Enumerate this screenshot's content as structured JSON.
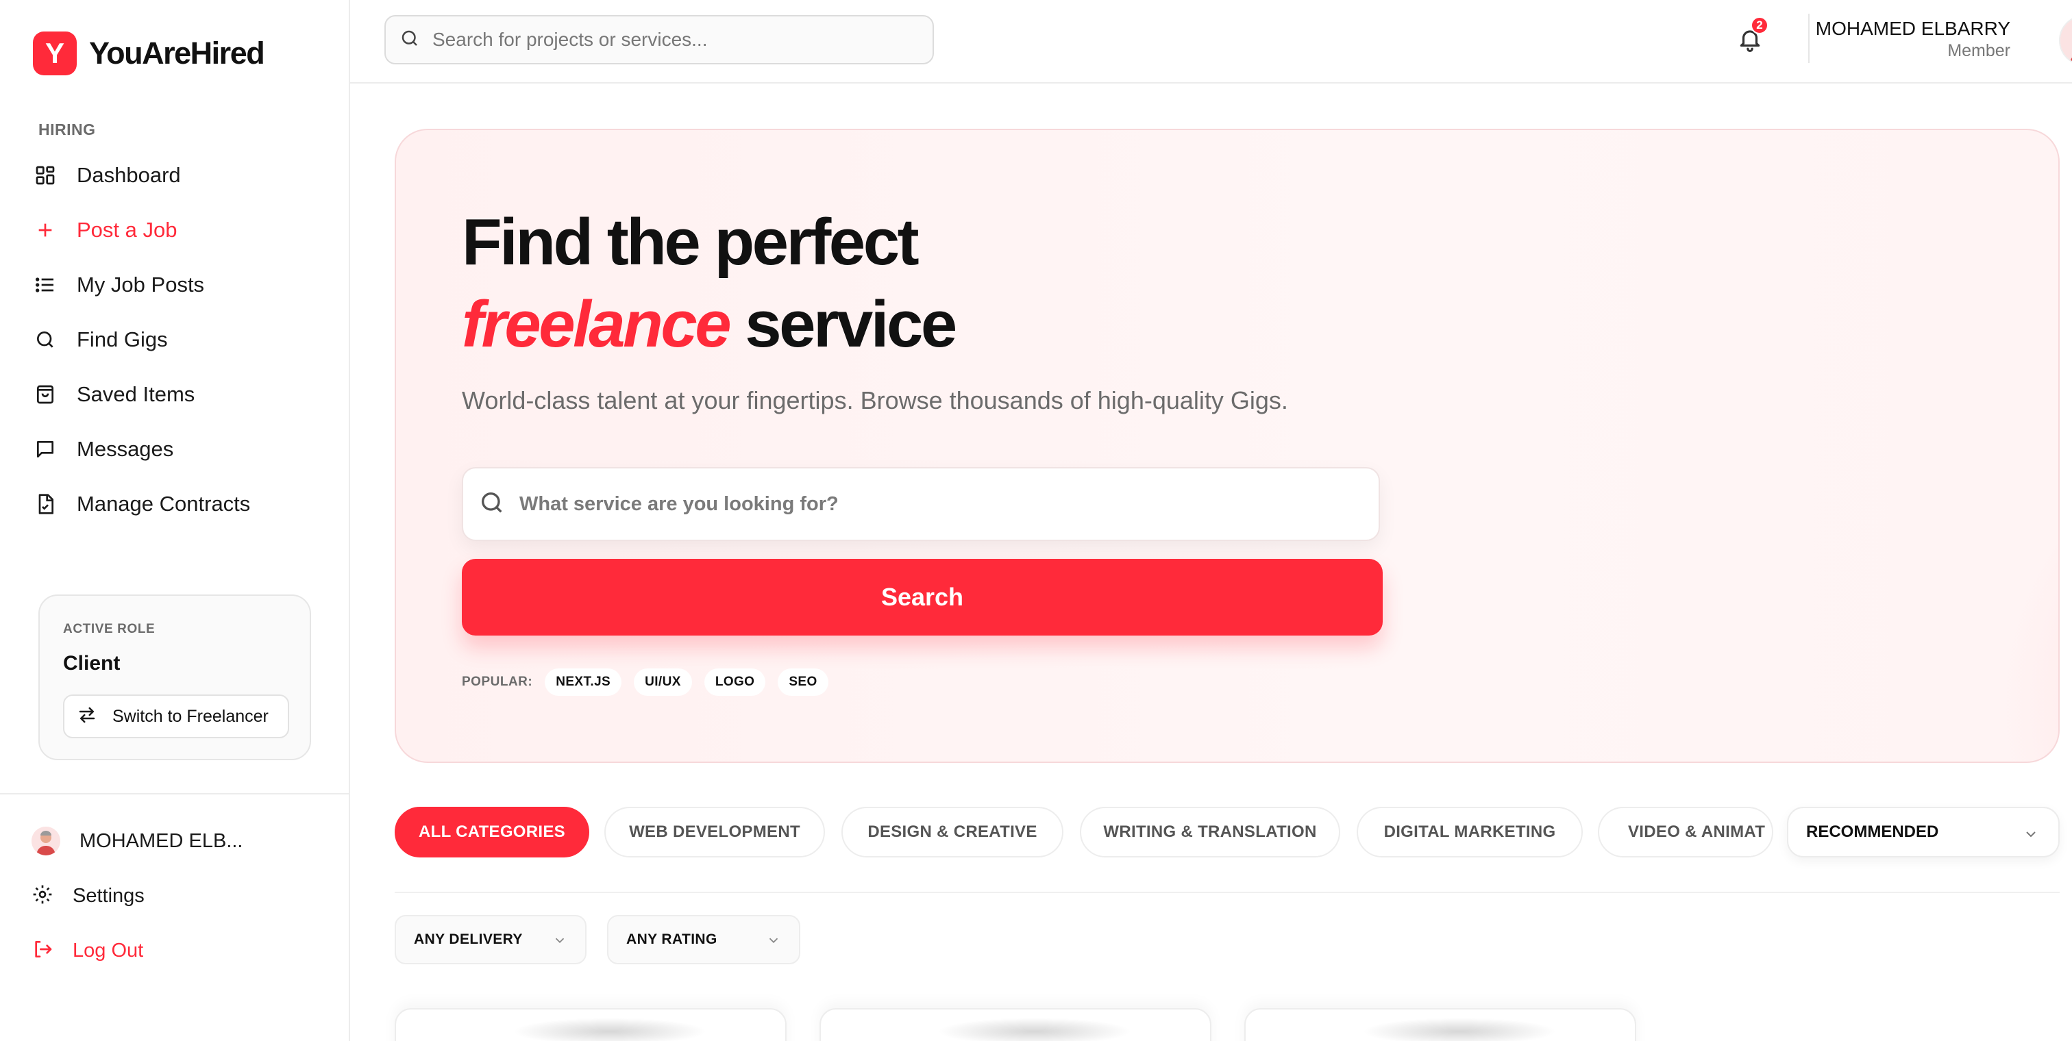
{
  "brand": {
    "logo_letter": "Y",
    "name": "YouAreHired",
    "color": "#ff2a3a"
  },
  "sidebar": {
    "section_label": "HIRING",
    "items": [
      {
        "label": "Dashboard",
        "icon": "grid-icon"
      },
      {
        "label": "Post a Job",
        "icon": "plus-icon",
        "active": true
      },
      {
        "label": "My Job Posts",
        "icon": "list-icon"
      },
      {
        "label": "Find Gigs",
        "icon": "search-icon"
      },
      {
        "label": "Saved Items",
        "icon": "shopping-bag-icon"
      },
      {
        "label": "Messages",
        "icon": "message-icon"
      },
      {
        "label": "Manage Contracts",
        "icon": "file-check-icon"
      }
    ],
    "role_card": {
      "title": "ACTIVE ROLE",
      "role": "Client",
      "switch_label": "Switch to Freelancer"
    },
    "bottom": {
      "user_name": "MOHAMED ELB...",
      "settings": "Settings",
      "logout": "Log Out"
    }
  },
  "topbar": {
    "search_placeholder": "Search for projects or services...",
    "notification_count": "2",
    "user_name": "MOHAMED ELBARRY",
    "user_role": "Member"
  },
  "hero": {
    "title_line1": "Find the perfect",
    "title_accent": "freelance",
    "title_rest": "service",
    "subtitle": "World-class talent at your fingertips. Browse thousands of high-quality Gigs.",
    "search_placeholder": "What service are you looking for?",
    "search_button": "Search",
    "popular_label": "POPULAR:",
    "popular_tags": [
      "NEXT.JS",
      "UI/UX",
      "LOGO",
      "SEO"
    ]
  },
  "categories": {
    "tabs": [
      "ALL CATEGORIES",
      "WEB DEVELOPMENT",
      "DESIGN & CREATIVE",
      "WRITING & TRANSLATION",
      "DIGITAL MARKETING",
      "VIDEO & ANIMAT"
    ],
    "active_index": 0,
    "sort_value": "RECOMMENDED"
  },
  "filters": {
    "delivery": "ANY DELIVERY",
    "rating": "ANY RATING"
  }
}
